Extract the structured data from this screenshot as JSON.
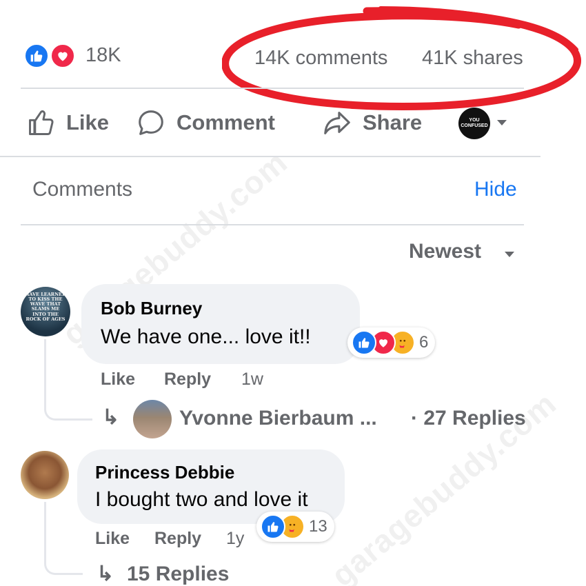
{
  "post_stats": {
    "reaction_count": "18K",
    "comments_count": "14K comments",
    "shares_count": "41K shares",
    "reaction_icons": [
      "like-icon",
      "love-icon"
    ]
  },
  "actions": {
    "like_label": "Like",
    "comment_label": "Comment",
    "share_label": "Share",
    "profile_avatar_text": "YOU CONFUSED"
  },
  "comments_section": {
    "title": "Comments",
    "hide_label": "Hide",
    "sort_label": "Newest"
  },
  "comments": [
    {
      "author": "Bob Burney",
      "text": "We have one... love it!!",
      "reaction_icons": [
        "like-icon",
        "love-icon",
        "care-icon"
      ],
      "reaction_count": "6",
      "like_label": "Like",
      "reply_label": "Reply",
      "time": "1w",
      "avatar_text": "HAVE LEARNED TO KISS THE WAVE THAT SLAMS ME INTO THE ROCK OF AGES",
      "reply_preview": {
        "name": "Yvonne Bierbaum ...",
        "replies": "· 27 Replies"
      }
    },
    {
      "author": "Princess Debbie",
      "text": "I bought two and love it",
      "reaction_icons": [
        "like-icon",
        "care-icon"
      ],
      "reaction_count": "13",
      "like_label": "Like",
      "reply_label": "Reply",
      "time": "1y",
      "replies": "15 Replies"
    }
  ],
  "watermark": "garagebuddy.com",
  "colors": {
    "accent_blue": "#1877f2",
    "love_red": "#f0284a",
    "annotation_red": "#e8202a",
    "muted_text": "#65676b",
    "bubble_bg": "#f0f2f5"
  }
}
